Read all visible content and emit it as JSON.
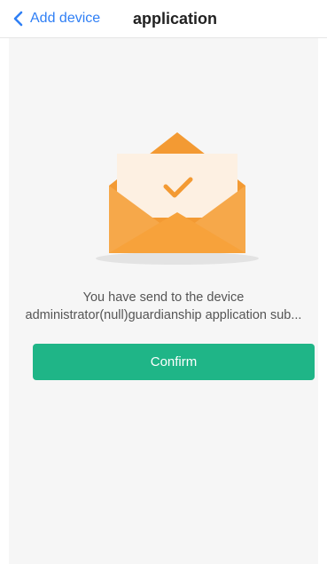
{
  "nav": {
    "back_label": "Add device",
    "title": "application"
  },
  "message": {
    "line1": "You have send to the device",
    "line2": "administrator(null)guardianship application sub..."
  },
  "confirm_label": "Confirm",
  "colors": {
    "accent_blue": "#2f7ff5",
    "confirm_green": "#1fb587",
    "envelope_orange": "#f7a23b",
    "envelope_dark_orange": "#f39a33",
    "letter_cream": "#fdf0e2",
    "check_orange": "#f39a33",
    "content_background": "#f6f6f6"
  },
  "icons": {
    "back": "chevron-left-icon",
    "illustration": "envelope-check-icon"
  }
}
